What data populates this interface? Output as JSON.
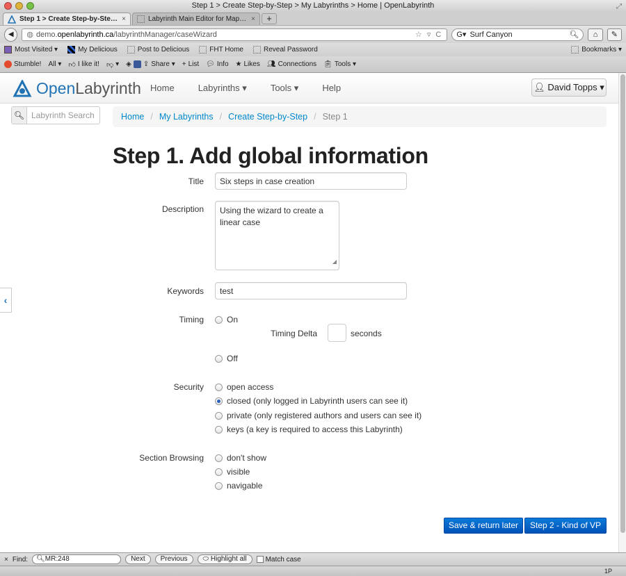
{
  "window": {
    "title": "Step 1 > Create Step-by-Step > My Labyrinths > Home | OpenLabyrinth"
  },
  "tabs": [
    {
      "label": "Step 1 > Create Step-by-Step >...",
      "close": "×"
    },
    {
      "label": "Labyrinth Main Editor for Map 1...",
      "close": "×"
    }
  ],
  "newtab": "+",
  "navbar": {
    "url_prefix": "demo.",
    "url_host": "openlabyrinth.ca",
    "url_path": "/labyrinthManager/caseWizard",
    "url_right": "☆ ▿ C",
    "search_engine": "Surf Canyon"
  },
  "bookmarks": {
    "items": [
      "Most Visited ▾",
      "My Delicious",
      "Post to Delicious",
      "FHT Home",
      "Reveal Password"
    ],
    "right": "Bookmarks ▾"
  },
  "toolbar2": {
    "items": [
      "Stumble!",
      "All ▾",
      "I like it!",
      "▾",
      "Share ▾",
      "List",
      "Info",
      "Likes",
      "Connections",
      "Tools ▾"
    ]
  },
  "app": {
    "logo_open": "Open",
    "logo_rest": "Labyrinth",
    "nav": [
      "Home",
      "Labyrinths ▾",
      "Tools ▾",
      "Help"
    ],
    "user": "David Topps ▾",
    "search_placeholder": "Labyrinth Search"
  },
  "breadcrumb": {
    "items": [
      "Home",
      "My Labyrinths",
      "Create Step-by-Step"
    ],
    "current": "Step 1",
    "sep": "/"
  },
  "form": {
    "heading": "Step 1. Add global information",
    "title_label": "Title",
    "title_value": "Six steps in case creation",
    "description_label": "Description",
    "description_value": "Using the wizard to create a linear case",
    "keywords_label": "Keywords",
    "keywords_value": "test",
    "timing_label": "Timing",
    "timing_on": "On",
    "timing_delta_label": "Timing Delta",
    "timing_seconds": "seconds",
    "timing_off": "Off",
    "security_label": "Security",
    "security_options": [
      "open access",
      "closed (only logged in Labyrinth users can see it)",
      "private (only registered authors and users can see it)",
      "keys (a key is required to access this Labyrinth)"
    ],
    "security_selected": "closed (only logged in Labyrinth users can see it)",
    "section_label": "Section Browsing",
    "section_options": [
      "don't show",
      "visible",
      "navigable"
    ],
    "save_button": "Save & return later",
    "next_button": "Step 2 - Kind of VP"
  },
  "findbar": {
    "close": "×",
    "label": "Find:",
    "value": "MR:248",
    "next": "Next",
    "previous": "Previous",
    "highlight": "Highlight all",
    "match_case": "Match case"
  },
  "status": {
    "right": "1P"
  },
  "colors": {
    "link": "#0088cc",
    "primary": "#0166c6",
    "logo_blue": "#2173b5"
  }
}
